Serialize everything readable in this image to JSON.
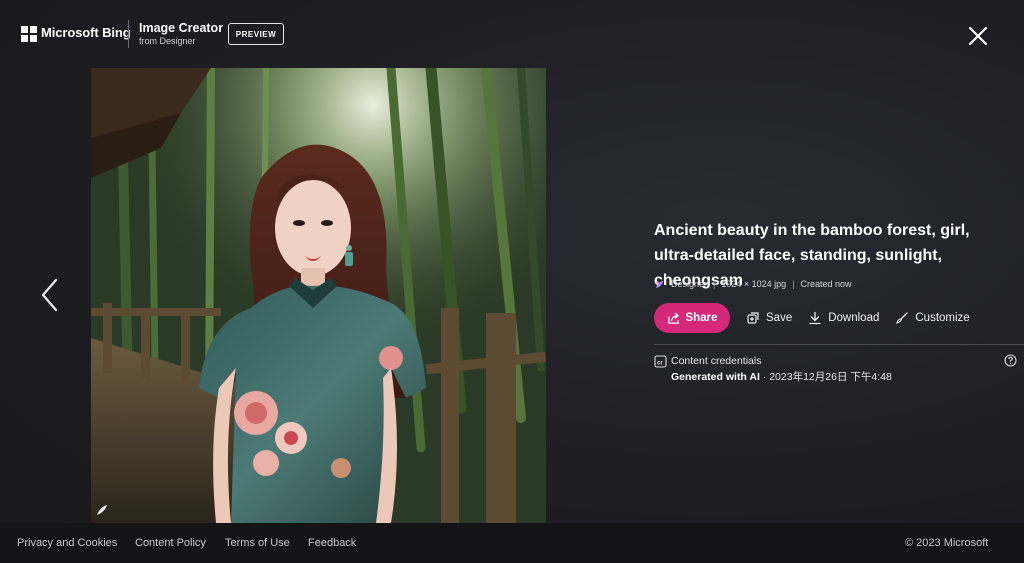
{
  "header": {
    "brand": "Microsoft Bing",
    "app_title": "Image Creator",
    "app_subtitle": "from Designer",
    "badge": "PREVIEW"
  },
  "image": {
    "prompt": "Ancient beauty in the bamboo forest, girl, ultra-detailed face, standing, sunlight, cheongsam",
    "source": "Designer",
    "dimensions": "1024 × 1024 jpg",
    "created": "Created now"
  },
  "actions": {
    "share": "Share",
    "save": "Save",
    "download": "Download",
    "customize": "Customize"
  },
  "credentials": {
    "label": "Content credentials",
    "generated": "Generated with AI",
    "timestamp": " · 2023年12月26日 下午4:48"
  },
  "footer": {
    "links": [
      "Privacy and Cookies",
      "Content Policy",
      "Terms of Use",
      "Feedback"
    ],
    "copyright": "© 2023 Microsoft"
  },
  "colors": {
    "accent": "#d6287a",
    "background": "#1f1f24",
    "footer": "#141416"
  }
}
